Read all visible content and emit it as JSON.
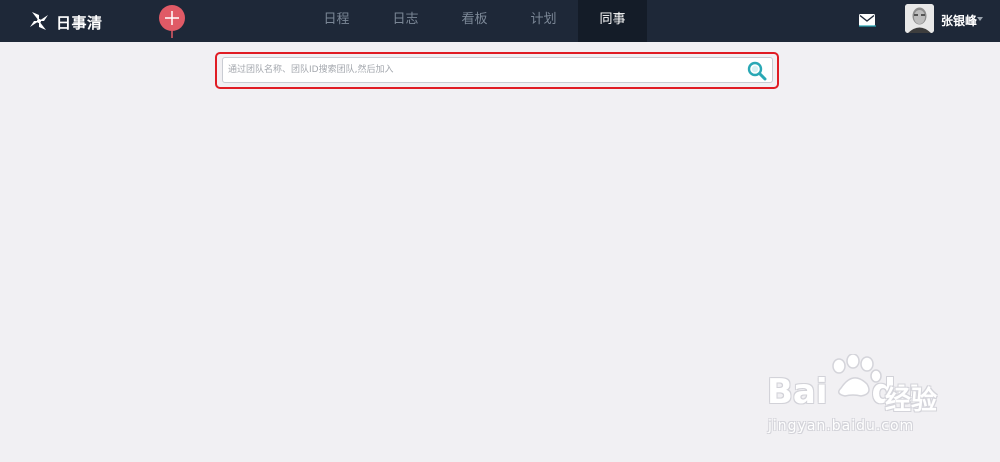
{
  "header": {
    "logo_text": "日事清",
    "add_button_icon": "plus-pin-icon",
    "nav_tabs": [
      {
        "label": "日程"
      },
      {
        "label": "日志"
      },
      {
        "label": "看板"
      },
      {
        "label": "计划"
      },
      {
        "label": "同事"
      }
    ],
    "active_tab": "同事",
    "mail_icon": "envelope-icon",
    "user": {
      "name": "张银峰"
    }
  },
  "search": {
    "placeholder": "通过团队名称、团队ID搜索团队,然后加入",
    "value": "",
    "icon": "magnifier-icon"
  },
  "watermark": {
    "brand": "Bai",
    "brand_suffix": "du",
    "product": "经验",
    "url": "jingyan.baidu.com"
  },
  "colors": {
    "header_bg": "#1e2838",
    "active_tab_bg": "#141c28",
    "page_bg": "#f1f0f3",
    "highlight_border": "#e01c24",
    "pin_red": "#e05a66",
    "search_icon": "#2aa8b5"
  }
}
